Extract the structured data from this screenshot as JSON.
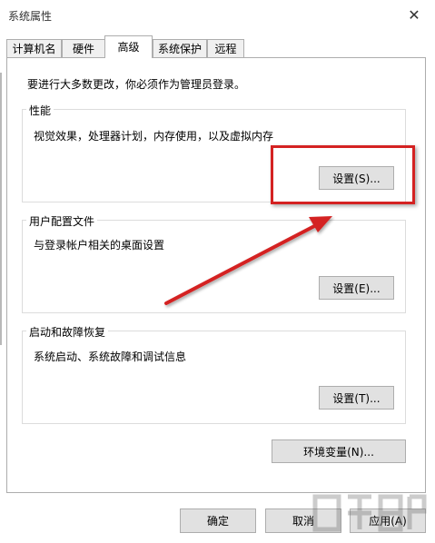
{
  "window": {
    "title": "系统属性",
    "close_glyph": "✕"
  },
  "tabs": [
    {
      "label": "计算机名",
      "active": false
    },
    {
      "label": "硬件",
      "active": false
    },
    {
      "label": "高级",
      "active": true
    },
    {
      "label": "系统保护",
      "active": false
    },
    {
      "label": "远程",
      "active": false
    }
  ],
  "advanced": {
    "intro": "要进行大多数更改，你必须作为管理员登录。",
    "performance": {
      "title": "性能",
      "description": "视觉效果，处理器计划，内存使用，以及虚拟内存",
      "button": "设置(S)..."
    },
    "user_profiles": {
      "title": "用户配置文件",
      "description": "与登录帐户相关的桌面设置",
      "button": "设置(E)..."
    },
    "startup_recovery": {
      "title": "启动和故障恢复",
      "description": "系统启动、系统故障和调试信息",
      "button": "设置(T)..."
    },
    "env_button": "环境变量(N)..."
  },
  "footer": {
    "ok": "确定",
    "cancel": "取消",
    "apply": "应用(A)"
  },
  "annotation": {
    "color": "#d42222"
  }
}
